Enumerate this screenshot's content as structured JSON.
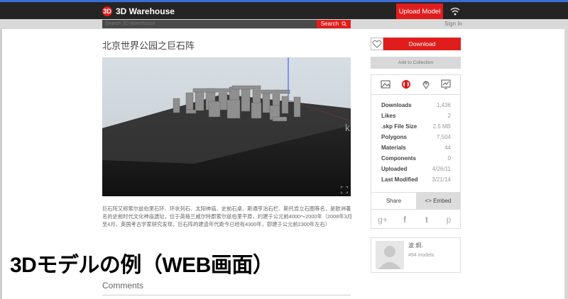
{
  "header": {
    "logo_mark": "3D",
    "logo_text": "3D Warehouse",
    "upload_label": "Upload Model"
  },
  "search": {
    "placeholder": "Search 3D Warehouse",
    "button_label": "Search",
    "signin_label": "Sign In"
  },
  "model": {
    "title": "北京世界公园之巨石阵",
    "description": "巨石阵又称索尔兹伯里石环、环状列石、太阳神庙、史前石桌、斯通亨治石栏、斯托肯立石圈等名，是欧洲著名的史前时代文化神庙遗址，位于英格兰威尔特郡索尔兹伯里平原，约建于公元前4000～2000年（2008年3月至4月，英国考古学家研究发现，巨石阵的建造年代距今已经有4300年，即建于公元前2300年左右）"
  },
  "actions": {
    "download_label": "Download",
    "collection_label": "Add to Collection"
  },
  "stats": [
    {
      "label": "Downloads",
      "value": "1,436"
    },
    {
      "label": "Likes",
      "value": "2"
    },
    {
      "label": ".skp File Size",
      "value": "2.5 MB"
    },
    {
      "label": "Polygons",
      "value": "7,504"
    },
    {
      "label": "Materials",
      "value": "44"
    },
    {
      "label": "Components",
      "value": "0"
    },
    {
      "label": "Uploaded",
      "value": "4/26/11"
    },
    {
      "label": "Last Modified",
      "value": "3/21/14"
    }
  ],
  "share": {
    "share_label": "Share",
    "embed_label": "<> Embed",
    "social": [
      "g+",
      "f",
      "t",
      "p"
    ]
  },
  "author": {
    "name": "波 炯.",
    "models": "494 models"
  },
  "comments_label": "Comments",
  "overlay_caption": "3Dモデルの例（WEB画面）",
  "colors": {
    "accent": "#e01d1d",
    "topbar": "#242424"
  }
}
